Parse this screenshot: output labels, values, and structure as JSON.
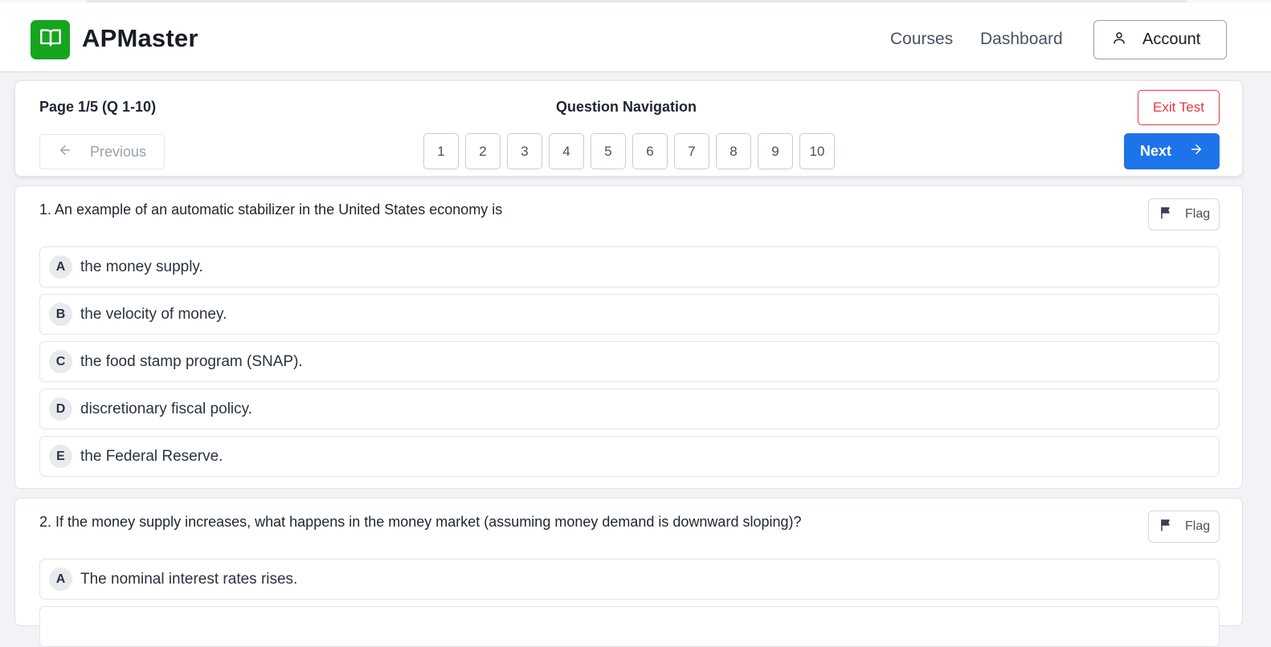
{
  "header": {
    "brand": "APMaster",
    "nav": {
      "courses": "Courses",
      "dashboard": "Dashboard"
    },
    "account_label": "Account",
    "accent_color": "#16a51f"
  },
  "nav_panel": {
    "page_info": "Page 1/5 (Q 1-10)",
    "title": "Question Navigation",
    "exit_label": "Exit Test",
    "previous_label": "Previous",
    "next_label": "Next",
    "question_numbers": [
      "1",
      "2",
      "3",
      "4",
      "5",
      "6",
      "7",
      "8",
      "9",
      "10"
    ],
    "primary_color": "#1d74e8",
    "danger_color": "#e4383d"
  },
  "questions": [
    {
      "text": "1. An example of an automatic stabilizer in the United States economy is",
      "flag_label": "Flag",
      "choices": [
        {
          "letter": "A",
          "text": "the money supply."
        },
        {
          "letter": "B",
          "text": "the velocity of money."
        },
        {
          "letter": "C",
          "text": "the food stamp program (SNAP)."
        },
        {
          "letter": "D",
          "text": "discretionary fiscal policy."
        },
        {
          "letter": "E",
          "text": "the Federal Reserve."
        }
      ]
    },
    {
      "text": "2. If the money supply increases, what happens in the money market (assuming money demand is downward sloping)?",
      "flag_label": "Flag",
      "choices": [
        {
          "letter": "A",
          "text": "The nominal interest rates rises."
        }
      ]
    }
  ]
}
